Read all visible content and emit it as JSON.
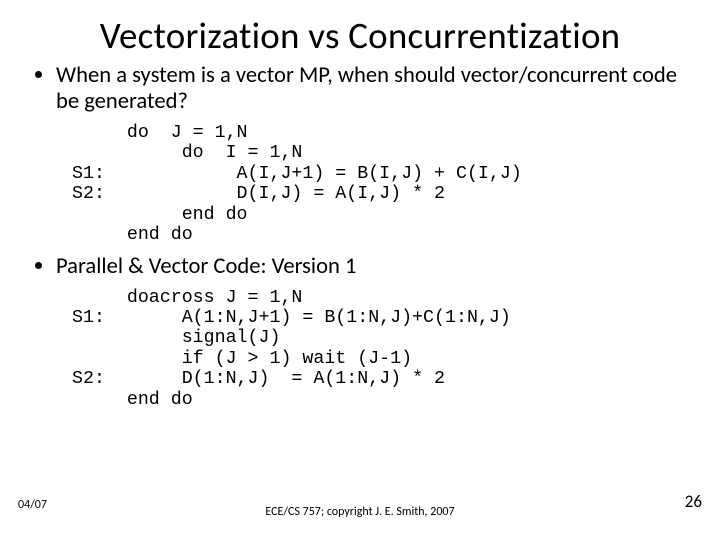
{
  "title": "Vectorization vs Concurrentization",
  "bullets": [
    "When a system is a vector MP, when should vector/concurrent code be generated?",
    "Parallel & Vector Code:  Version 1"
  ],
  "code1": "     do  J = 1,N\n          do  I = 1,N\nS1:            A(I,J+1) = B(I,J) + C(I,J)\nS2:            D(I,J) = A(I,J) * 2\n          end do\n     end do",
  "code2": "     doacross J = 1,N\nS1:       A(1:N,J+1) = B(1:N,J)+C(1:N,J)\n          signal(J)\n          if (J > 1) wait (J-1)\nS2:       D(1:N,J)  = A(1:N,J) * 2\n     end do",
  "footer": {
    "left": "04/07",
    "center": "ECE/CS 757; copyright J. E. Smith, 2007",
    "right": "26"
  }
}
